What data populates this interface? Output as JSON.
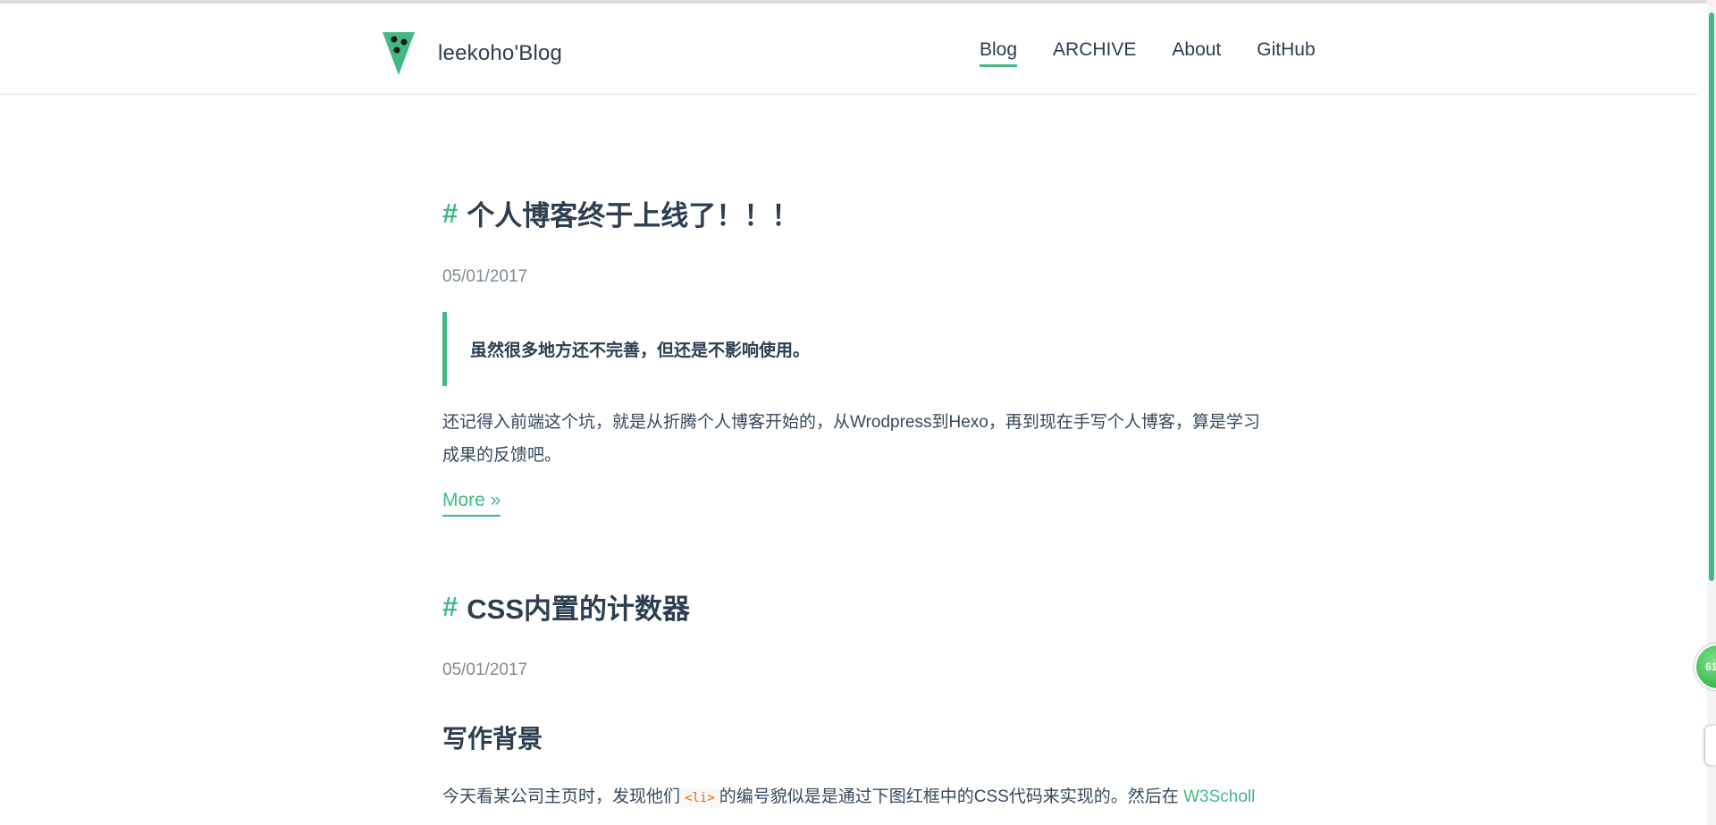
{
  "header": {
    "brand_name": "leekoho'Blog",
    "nav": [
      {
        "label": "Blog",
        "active": true
      },
      {
        "label": "ARCHIVE",
        "active": false
      },
      {
        "label": "About",
        "active": false
      },
      {
        "label": "GitHub",
        "active": false
      }
    ]
  },
  "posts": [
    {
      "hash": "#",
      "title": "个人博客终于上线了！！！",
      "date": "05/01/2017",
      "quote": "虽然很多地方还不完善，但还是不影响使用。",
      "excerpt": "还记得入前端这个坑，就是从折腾个人博客开始的，从Wrodpress到Hexo，再到现在手写个人博客，算是学习成果的反馈吧。",
      "more_label": "More »"
    },
    {
      "hash": "#",
      "title": "CSS内置的计数器",
      "date": "05/01/2017",
      "section_heading": "写作背景",
      "paragraph_prefix": "今天看某公司主页时，发现他们",
      "inline_code": "<li>",
      "paragraph_middle": "的编号貌似是是通过下图红框中的CSS代码来实现的。然后在",
      "link_text": "W3Scholl"
    }
  ],
  "widgets": {
    "floating_badge_text": "61"
  },
  "colors": {
    "accent": "#42b983",
    "text": "#2c3e50",
    "muted": "#7f8c8d"
  }
}
